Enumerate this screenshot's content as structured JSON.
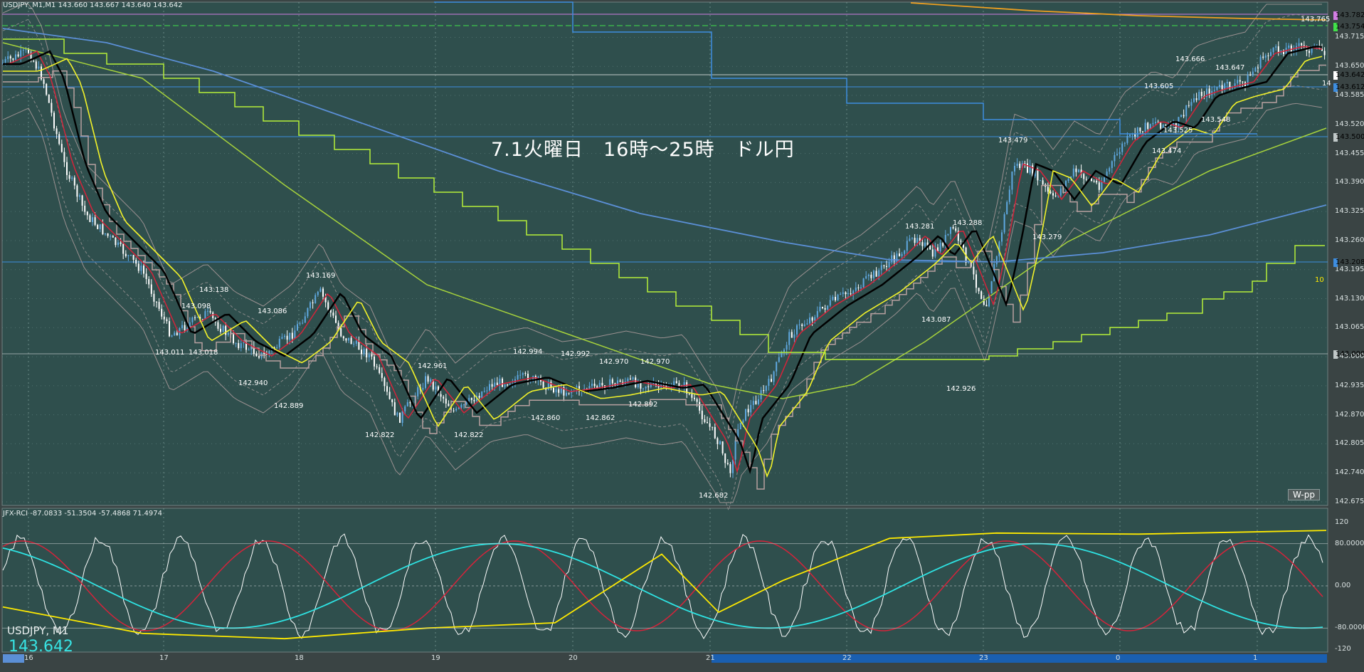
{
  "window": {
    "symbol_header": "USDJPY_M1,M1  143.660 143.667 143.640 143.642",
    "title_annotation": "7.1火曜日　16時～25時　ドル円",
    "wpp_label": "W-pp",
    "countdown": "10"
  },
  "colors": {
    "main_bg": "#2f4f4d",
    "indicator_bg": "#2f4f4d",
    "grid": "#8fb0ac",
    "candle_up": "#5fa8e0",
    "candle_down": "#ffffff",
    "ma_fast": "#d6233a",
    "ma_black": "#000000",
    "ma_yellow": "#f2f22a",
    "ma_lightgreen": "#a6d23c",
    "ma_blue": "#5b8fd6",
    "ma_orange": "#f0a020",
    "ichimoku": "#b8a0a0",
    "step_green": "#b5ef3a",
    "step_blue": "#3e8ee0",
    "rci_white": "#ffffff",
    "rci_red": "#d6233a",
    "rci_cyan": "#2ee3e3",
    "rci_yellow": "#ffea00"
  },
  "price_axis": {
    "labels": [
      "143.715",
      "143.650",
      "143.585",
      "143.520",
      "143.455",
      "143.390",
      "143.325",
      "143.260",
      "143.195",
      "143.130",
      "143.065",
      "143.000",
      "142.935",
      "142.870",
      "142.805",
      "142.740",
      "142.675"
    ],
    "tags": [
      {
        "text": "143.782",
        "bg": "#d27ee3"
      },
      {
        "text": "143.754",
        "bg": "#41e04a"
      },
      {
        "text": "143.642",
        "bg": "#ffffff"
      },
      {
        "text": "143.612",
        "bg": "#3e8ee0"
      },
      {
        "text": "143.500",
        "bg": "#c0c8c8"
      },
      {
        "text": "143.208",
        "bg": "#3e8ee0"
      },
      {
        "text": "143.000",
        "bg": "#c0c8c8"
      }
    ],
    "small_label": "14"
  },
  "price_annotations": [
    {
      "text": "143.765"
    },
    {
      "text": "143.666"
    },
    {
      "text": "143.647"
    },
    {
      "text": "143.605"
    },
    {
      "text": "143.525"
    },
    {
      "text": "143.548"
    },
    {
      "text": "143.474"
    },
    {
      "text": "143.479"
    },
    {
      "text": "143.279"
    },
    {
      "text": "143.281"
    },
    {
      "text": "143.288"
    },
    {
      "text": "143.087"
    },
    {
      "text": "142.926"
    },
    {
      "text": "143.138"
    },
    {
      "text": "143.098"
    },
    {
      "text": "143.011"
    },
    {
      "text": "143.018"
    },
    {
      "text": "143.086"
    },
    {
      "text": "142.940"
    },
    {
      "text": "143.169"
    },
    {
      "text": "142.889"
    },
    {
      "text": "142.822"
    },
    {
      "text": "142.961"
    },
    {
      "text": "142.822"
    },
    {
      "text": "142.994"
    },
    {
      "text": "142.860"
    },
    {
      "text": "142.992"
    },
    {
      "text": "142.970"
    },
    {
      "text": "142.970"
    },
    {
      "text": "142.862"
    },
    {
      "text": "142.892"
    },
    {
      "text": "142.682"
    }
  ],
  "indicator": {
    "header": "JFX-RCI -87.0833 -51.3504 -57.4868 71.4974",
    "axis_labels": [
      "120",
      "80.0000",
      "0.00",
      "-80.0000",
      "-120"
    ],
    "symbol_label": "USDJPY, M1",
    "price_big": "143.642"
  },
  "time_axis": {
    "labels": [
      "16",
      "17",
      "18",
      "19",
      "20",
      "21",
      "22",
      "23",
      "0",
      "1"
    ]
  }
}
